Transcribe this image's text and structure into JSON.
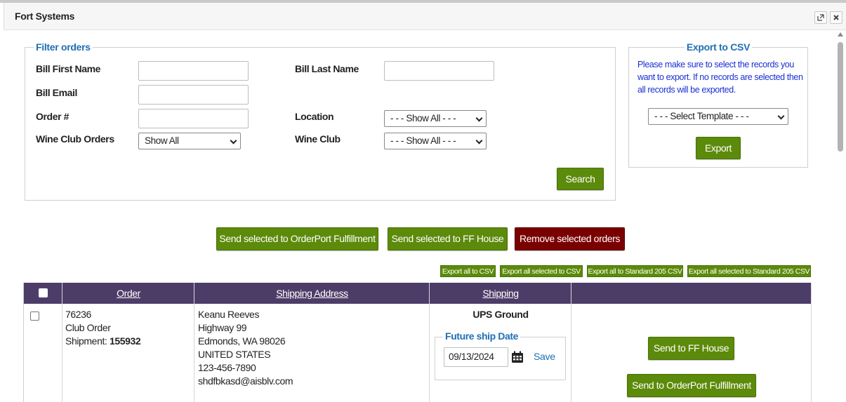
{
  "window": {
    "title": "Fort Systems",
    "popout_icon": "popout-icon",
    "close_icon": "close-icon"
  },
  "filter": {
    "legend": "Filter orders",
    "bill_first_name_label": "Bill First Name",
    "bill_last_name_label": "Bill Last Name",
    "bill_email_label": "Bill Email",
    "order_label": "Order #",
    "location_label": "Location",
    "location_value": "- - - Show All - - -",
    "wine_club_orders_label": "Wine Club Orders",
    "wine_club_orders_value": "Show All",
    "wine_club_label": "Wine Club",
    "wine_club_value": "- - - Show All - - -",
    "search_label": "Search"
  },
  "export": {
    "legend": "Export to CSV",
    "info": "Please make sure to select the records you want to export. If no records are selected then all records will be exported.",
    "template_value": "- - - Select Template - - -",
    "export_label": "Export"
  },
  "actions": {
    "send_orderport": "Send selected to OrderPort Fulfillment",
    "send_ff_house": "Send selected to FF House",
    "remove_selected": "Remove selected orders"
  },
  "csv_buttons": {
    "export_all": "Export all to CSV",
    "export_all_selected": "Export all selected to CSV",
    "export_all_std": "Export all to Standard 205 CSV",
    "export_all_selected_std": "Export all selected to Standard 205 CSV"
  },
  "table": {
    "headers": {
      "order": "Order",
      "shipping_address": "Shipping Address",
      "shipping": "Shipping"
    },
    "rows": [
      {
        "order_id": "76236",
        "order_type": "Club Order",
        "shipment_label": "Shipment:",
        "shipment_id": "155932",
        "name": "Keanu Reeves",
        "street": "Highway 99",
        "city": "Edmonds, WA 98026",
        "country": "UNITED STATES",
        "phone": "123-456-7890",
        "email": "shdfbkasd@aisblv.com",
        "shipping_method": "UPS Ground",
        "future_ship_legend": "Future ship Date",
        "future_ship_date": "09/13/2024",
        "calendar_icon": "calendar-icon",
        "save_label": "Save",
        "send_ff_house": "Send to FF House",
        "send_orderport": "Send to OrderPort Fulfillment"
      }
    ]
  },
  "colors": {
    "accent_green": "#5c8a0a",
    "danger_red": "#7a0000",
    "header_purple": "#4c3d68",
    "legend_blue": "#1f6fb5"
  }
}
